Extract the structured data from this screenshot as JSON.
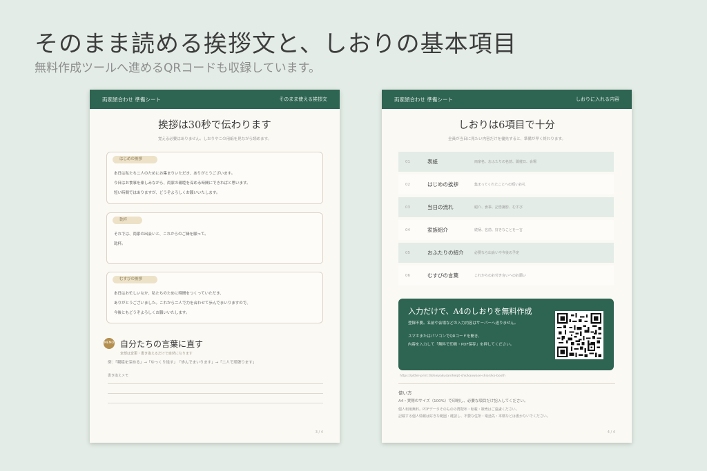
{
  "hero": {
    "title": "そのまま読める挨拶文と、しおりの基本項目",
    "subtitle": "無料作成ツールへ進めるQRコードも収録しています。"
  },
  "colors": {
    "background": "#e3ece6",
    "green": "#2e6452",
    "paper": "#fbf9f4",
    "pill": "#ede2c8",
    "memo": "#b48f4f"
  },
  "left_sheet": {
    "header_title": "両家顔合わせ 準備シート",
    "header_right": "そのまま使える挨拶文",
    "title": "挨拶は30秒で伝わります",
    "subtitle": "覚える必要はありません。しおりやこの用紙を見ながら読めます。",
    "blocks": [
      {
        "label": "はじめの挨拶",
        "lines": [
          "本日は私たち二人のためにお集まりいただき、ありがとうございます。",
          "今日はお食事を楽しみながら、両家の親睦を深める時間にできればと思います。",
          "短い時間ではありますが、どうぞよろしくお願いいたします。"
        ]
      },
      {
        "label": "乾杯",
        "lines": [
          "それでは、両家の出会いと、これからのご縁を願って。",
          "乾杯。"
        ]
      },
      {
        "label": "むすびの挨拶",
        "lines": [
          "本日はお忙しいなか、私たちのために時間をつくっていただき、",
          "ありがとうございました。これから二人で力を合わせて歩んでまいりますので、",
          "今後ともどうぞよろしくお願いいたします。"
        ]
      }
    ],
    "memo": {
      "badge": "MEMO",
      "title": "自分たちの言葉に直す",
      "subtitle": "全部は変更・書き換えるだけで自然になります",
      "example": "例：「親睦を深める」→「ゆっくり話す」　「歩んでまいります」→「二人で頑張ります」",
      "note": "書き換えメモ"
    },
    "page": "3 / 4"
  },
  "right_sheet": {
    "header_title": "両家顔合わせ 準備シート",
    "header_right": "しおりに入れる内容",
    "title": "しおりは6項目で十分",
    "subtitle": "全員が当日に見たい内容だけを優先すると、準備が早く終わります。",
    "items": [
      {
        "num": "01",
        "name": "表紙",
        "desc": "両家名、おふたりの名前、開催日、会場"
      },
      {
        "num": "02",
        "name": "はじめの挨拶",
        "desc": "集まってくれたことへの短いお礼"
      },
      {
        "num": "03",
        "name": "当日の流れ",
        "desc": "紹介、食事、記念撮影、むすび"
      },
      {
        "num": "04",
        "name": "家族紹介",
        "desc": "続柄、名前、好きなことを一言"
      },
      {
        "num": "05",
        "name": "おふたりの紹介",
        "desc": "必要なら出会いや今後の予定"
      },
      {
        "num": "06",
        "name": "むすびの言葉",
        "desc": "これからのお付き合いへのお願い"
      }
    ],
    "cta": {
      "title": "入力だけで、A4のしおりを無料作成",
      "line1": "登録不要。名前や会場などの入力内容はサーバーへ送りません。",
      "line2": "スマホまたはパソコンでQRコードを開き、",
      "line3": "内容を入力して「無料で印刷・PDF保存」を押してください。"
    },
    "url": "https://pitter-print.tld/seiyakusan/helpt-shk/kaowase-shiori/ko-booth",
    "how": {
      "title": "使い方",
      "line1": "A4・実際のサイズ（100%）で印刷し、必要な項目だけ記入してください。",
      "line2": "個人利用無料。PDFデータそのものの再配布・転載・販売はご遠慮ください。",
      "line3": "記載する個人情報は好きな範囲・確認し、不要な住所・電話先・本籍などは書かないでください。"
    },
    "page": "4 / 4"
  }
}
